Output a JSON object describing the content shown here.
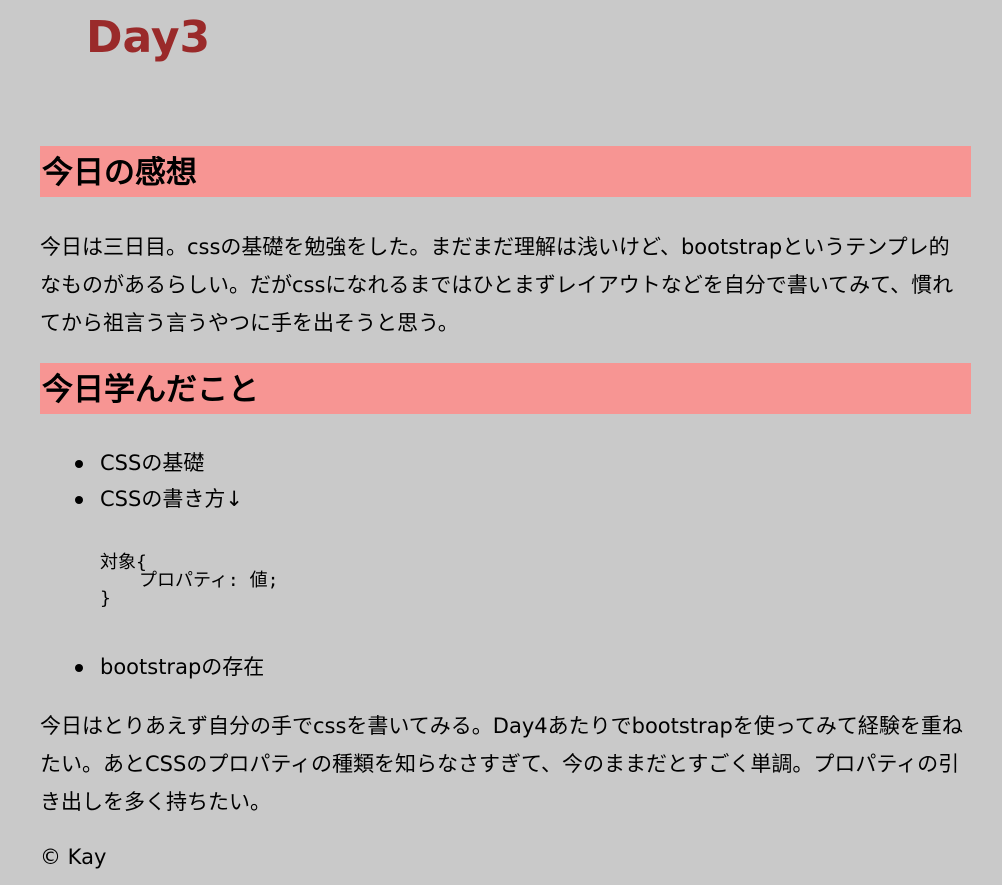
{
  "page_title": "Day3",
  "sections": [
    {
      "heading": "今日の感想",
      "paragraph": "今日は三日目。cssの基礎を勉強をした。まだまだ理解は浅いけど、bootstrapというテンプレ的なものがあるらしい。だがcssになれるまではひとまずレイアウトなどを自分で書いてみて、慣れてから祖言う言うやつに手を出そうと思う。"
    },
    {
      "heading": "今日学んだこと",
      "items": [
        "CSSの基礎",
        "CSSの書き方↓",
        "bootstrapの存在"
      ],
      "code": {
        "line1": "対象{",
        "line2": "プロパティ: 値;",
        "line3": "}"
      }
    }
  ],
  "closing_paragraph": "今日はとりあえず自分の手でcssを書いてみる。Day4あたりでbootstrapを使ってみて経験を重ねたい。あとCSSのプロパティの種類を知らなさすぎて、今のままだとすごく単調。プロパティの引き出しを多く持ちたい。",
  "footer": "© Kay",
  "colors": {
    "background": "#c9c9c9",
    "title": "#9a2a2a",
    "heading_band": "#f79593"
  }
}
